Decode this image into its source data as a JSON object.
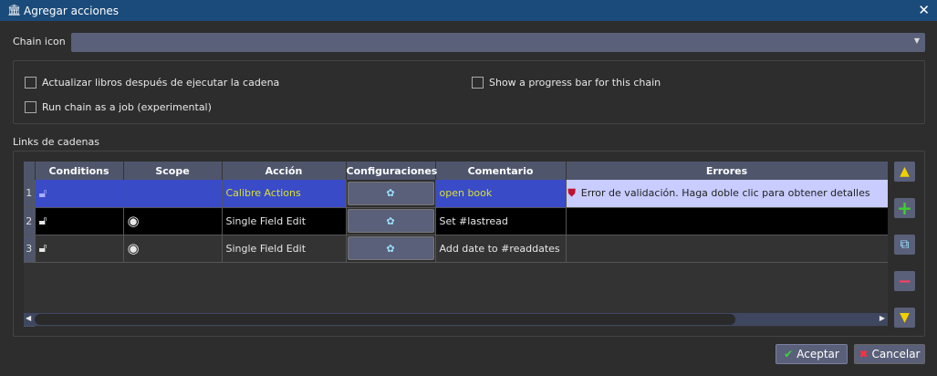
{
  "window": {
    "title": "Agregar acciones"
  },
  "chain_icon": {
    "label": "Chain icon",
    "value": ""
  },
  "options": {
    "update_books": {
      "label": "Actualizar libros después de ejecutar la cadena",
      "checked": false
    },
    "progress_bar": {
      "label": "Show a progress bar for this chain",
      "checked": false
    },
    "run_as_job": {
      "label": "Run chain as a job (experimental)",
      "checked": false
    }
  },
  "links": {
    "label": "Links de cadenas",
    "columns": [
      "Conditions",
      "Scope",
      "Acción",
      "Configuraciones",
      "Comentario",
      "Errores"
    ],
    "rows": [
      {
        "num": "1",
        "condition_icon": "unlock-icon",
        "scope_icon": "",
        "action": "Calibre Actions",
        "config_icon": "gear-icon",
        "comment": "open book",
        "error": "Error de validación. Haga doble clic para obtener detalles",
        "selected": true
      },
      {
        "num": "2",
        "condition_icon": "unlock-icon",
        "scope_icon": "target-icon",
        "action": "Single Field Edit",
        "config_icon": "gear-icon",
        "comment": "Set #lastread",
        "error": ""
      },
      {
        "num": "3",
        "condition_icon": "unlock-icon",
        "scope_icon": "target-icon",
        "action": "Single Field Edit",
        "config_icon": "gear-icon",
        "comment": "Add date to #readdates",
        "error": ""
      }
    ]
  },
  "buttons": {
    "ok": "Aceptar",
    "cancel": "Cancelar"
  },
  "colors": {
    "selection": "#3a4bc8",
    "error_cell": "#c8ccff",
    "action_highlight": "#d8e030"
  }
}
